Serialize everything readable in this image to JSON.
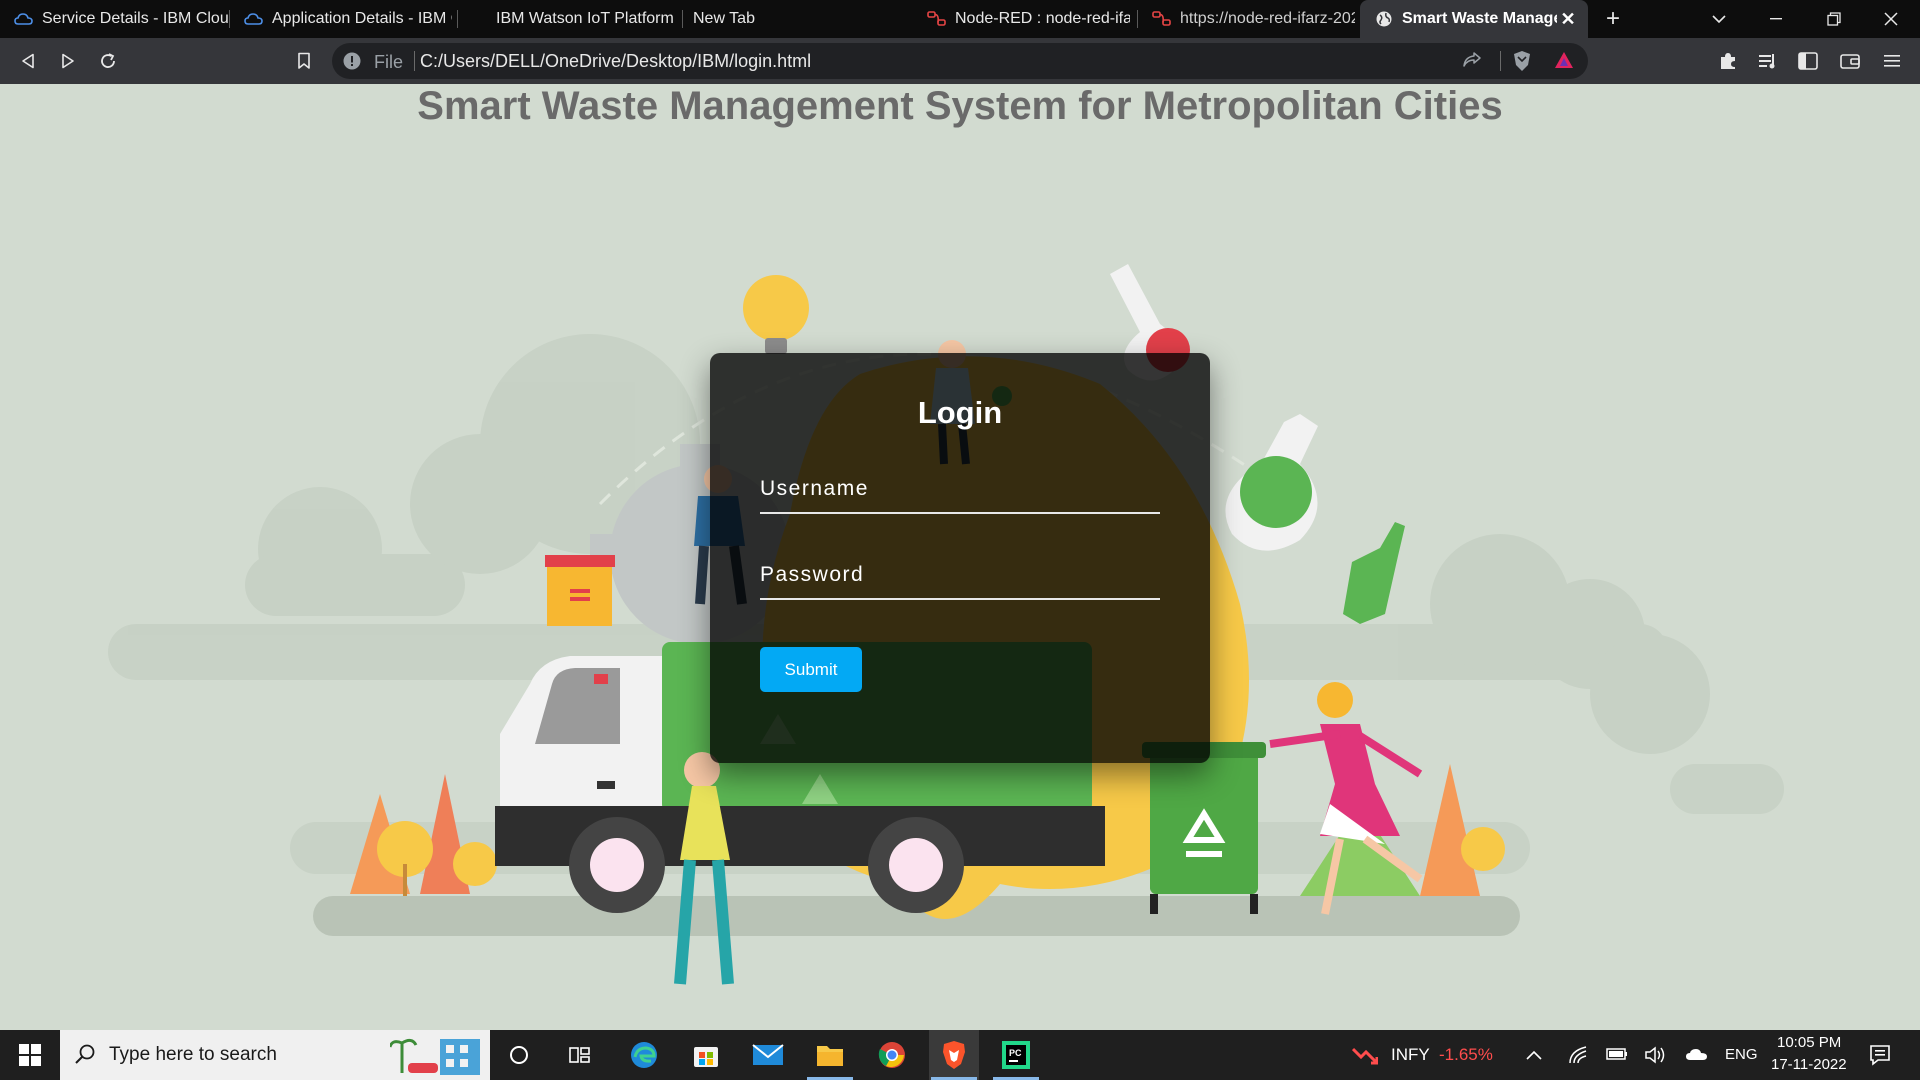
{
  "browser": {
    "tabs": [
      {
        "title": "Service Details - IBM Cloud",
        "icon": "ibm-cloud-icon"
      },
      {
        "title": "Application Details - IBM C",
        "icon": "ibm-cloud-icon"
      },
      {
        "title": "IBM Watson IoT Platform",
        "icon": ""
      },
      {
        "title": "New Tab",
        "icon": ""
      },
      {
        "title": "Node-RED : node-red-ifarz",
        "icon": "node-red-icon"
      },
      {
        "title": "https://node-red-ifarz-202",
        "icon": "node-red-icon"
      },
      {
        "title": "Smart Waste Managem",
        "icon": "globe-icon",
        "active": true
      }
    ],
    "address": {
      "scheme_label": "File",
      "url": "C:/Users/DELL/OneDrive/Desktop/IBM/login.html"
    }
  },
  "page": {
    "title": "Smart Waste Management System for Metropolitan Cities",
    "login": {
      "heading": "Login",
      "username_placeholder": "Username",
      "password_placeholder": "Password",
      "submit_label": "Submit"
    }
  },
  "taskbar": {
    "search_placeholder": "Type here to search",
    "stock": {
      "symbol": "INFY",
      "change": "-1.65%",
      "change_color": "#ff4d4d"
    },
    "language": "ENG",
    "time": "10:05 PM",
    "date": "17-11-2022",
    "apps": [
      "edge-icon",
      "store-icon",
      "mail-icon",
      "file-explorer-icon",
      "chrome-icon",
      "brave-icon",
      "pycharm-icon"
    ]
  },
  "colors": {
    "page_background": "#d2dbd0",
    "submit_button": "#03a9f4",
    "title_text": "#6a6a6a"
  }
}
